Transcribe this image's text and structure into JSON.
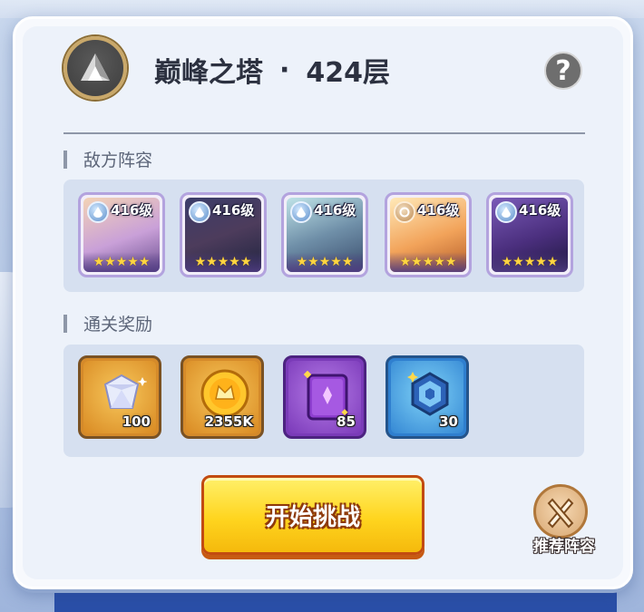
{
  "header": {
    "title": "巅峰之塔",
    "separator": "·",
    "floor": "424层",
    "help_label": "?"
  },
  "enemy_section": {
    "title": "敌方阵容",
    "heroes": [
      {
        "level": "416级",
        "element": "water-icon",
        "stars": 5
      },
      {
        "level": "416级",
        "element": "water-icon",
        "stars": 5
      },
      {
        "level": "416级",
        "element": "water-icon",
        "stars": 5
      },
      {
        "level": "416级",
        "element": "earth-icon",
        "stars": 5
      },
      {
        "level": "416级",
        "element": "water-icon",
        "stars": 5
      }
    ]
  },
  "reward_section": {
    "title": "通关奖励",
    "rewards": [
      {
        "item": "diamond-icon",
        "quantity": "100"
      },
      {
        "item": "gold-coin-icon",
        "quantity": "2355K"
      },
      {
        "item": "purple-book-icon",
        "quantity": "85"
      },
      {
        "item": "blue-crystal-icon",
        "quantity": "30"
      }
    ]
  },
  "actions": {
    "start_label": "开始挑战",
    "recommend_label": "推荐阵容"
  },
  "colors": {
    "start_button": "#ffd51f",
    "panel_bg": "#edf2fa",
    "strip_bg": "#d6e0f0",
    "hero_border": "#b3a3de",
    "title_text": "#2c3140"
  }
}
